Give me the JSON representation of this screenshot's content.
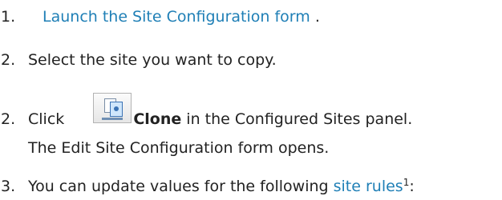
{
  "steps": [
    {
      "number": "1.",
      "link_text": "Launch the Site Configuration form",
      "suffix": " ."
    },
    {
      "number": "2.",
      "text": "Select the site you want to copy."
    },
    {
      "number": "2.",
      "prefix": "Click ",
      "icon": "clone-icon",
      "bold_text": "Clone",
      "suffix": " in the Configured Sites panel.",
      "result": "The Edit Site Configuration form opens."
    },
    {
      "number": "3.",
      "prefix": "You can update values for the following ",
      "link_text": "site rules",
      "footnote": "1",
      "suffix": ":"
    }
  ],
  "colors": {
    "text": "#222222",
    "link": "#1f7fb6"
  }
}
